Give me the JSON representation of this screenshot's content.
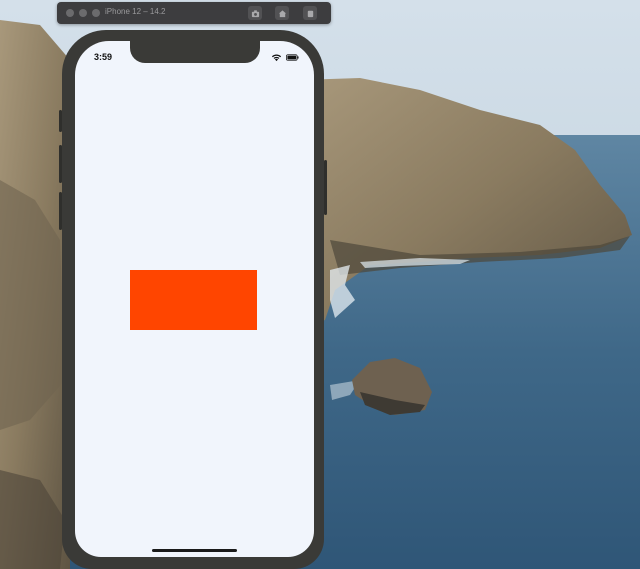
{
  "simulator": {
    "title": "iPhone 12 – 14.2"
  },
  "status_bar": {
    "time": "3:59"
  },
  "icons": {
    "screenshot": "camera-icon",
    "home": "home-icon",
    "rotate": "rotate-icon",
    "wifi": "wifi-icon",
    "battery": "battery-icon"
  },
  "colors": {
    "rect": "#ff4500",
    "screen_bg": "#f1f5fc",
    "phone_frame": "#3a3a37"
  }
}
